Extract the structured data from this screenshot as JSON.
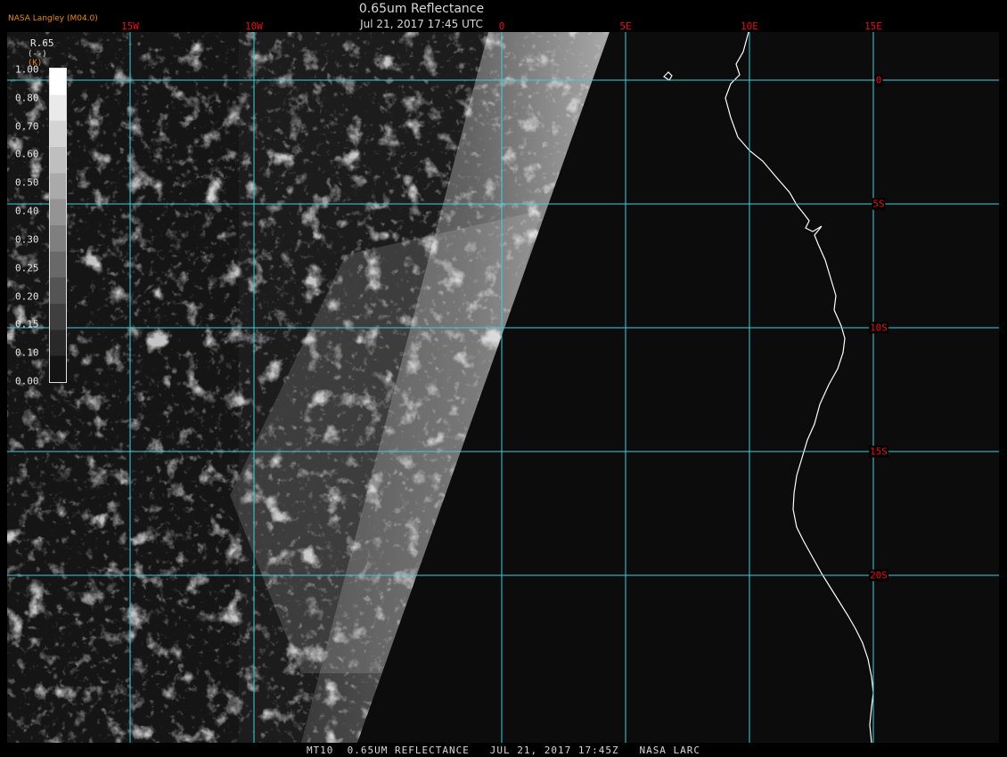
{
  "header": {
    "title": "0.65um Reflectance",
    "datetime": "Jul 21, 2017 17:45 UTC",
    "producer": "NASA Langley (M04.0)"
  },
  "footer": {
    "text": "MT10  0.65UM REFLECTANCE   JUL 21, 2017 17:45Z   NASA LARC"
  },
  "map": {
    "longitudes": [
      {
        "value": -15,
        "label": "15W"
      },
      {
        "value": -10,
        "label": "10W"
      },
      {
        "value": 0,
        "label": "0"
      },
      {
        "value": 5,
        "label": "5E"
      },
      {
        "value": 10,
        "label": "10E"
      },
      {
        "value": 15,
        "label": "15E"
      }
    ],
    "latitudes": [
      {
        "value": 0,
        "label": "0"
      },
      {
        "value": -5,
        "label": "5S"
      },
      {
        "value": -10,
        "label": "10S"
      },
      {
        "value": -15,
        "label": "15S"
      },
      {
        "value": -20,
        "label": "20S"
      }
    ],
    "grid_color": "#3fd0d8",
    "label_color": "#e21212",
    "coastline_color": "#ffffff"
  },
  "legend": {
    "title": "R.65",
    "units": "(--)",
    "unit_marker": "(K)",
    "ticks": [
      "1.00",
      "0.80",
      "0.70",
      "0.60",
      "0.50",
      "0.40",
      "0.30",
      "0.25",
      "0.20",
      "0.15",
      "0.10",
      "0.00"
    ]
  }
}
